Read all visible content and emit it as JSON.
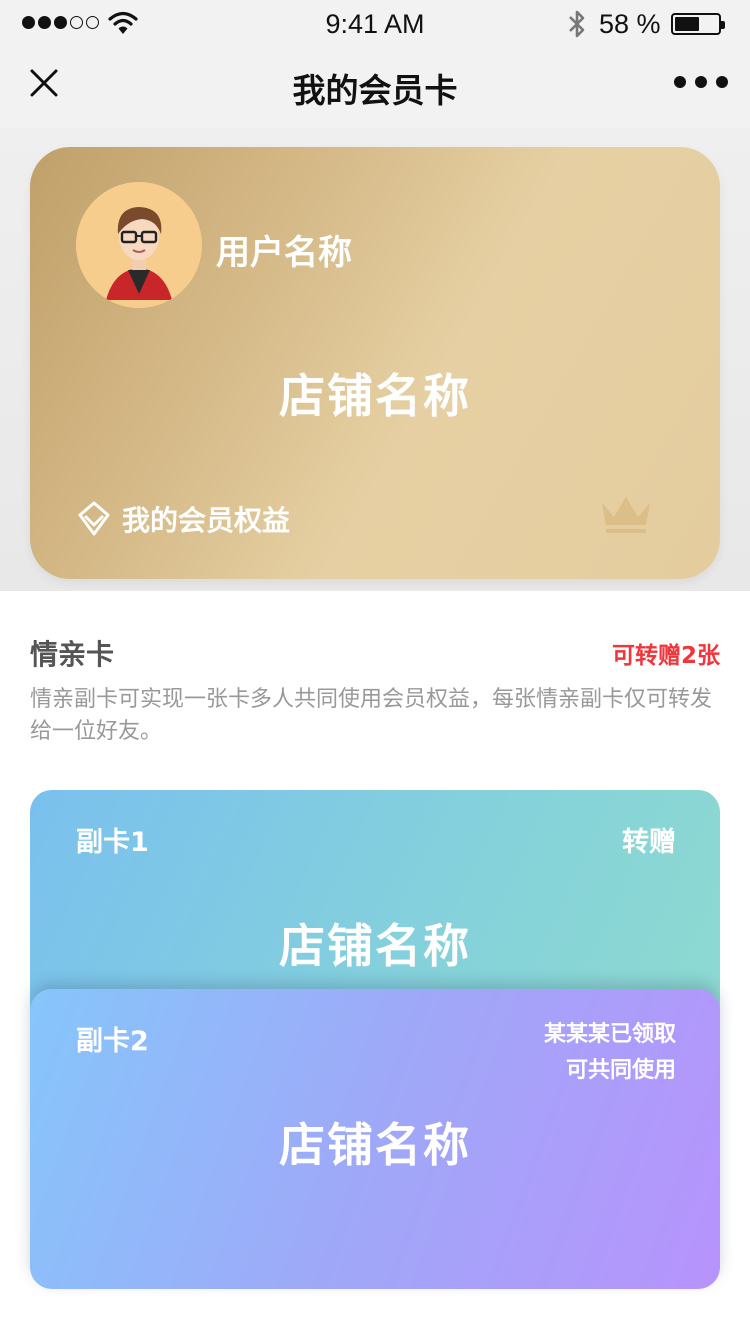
{
  "status_bar": {
    "time": "9:41 AM",
    "battery_percent": "58 %",
    "battery_level": 0.58,
    "signal_bars_filled": 3,
    "signal_bars_total": 5,
    "icons": [
      "signal-dots-icon",
      "wifi-icon",
      "bluetooth-icon",
      "battery-icon"
    ]
  },
  "nav": {
    "title": "我的会员卡",
    "close_icon": "close-icon",
    "more_icon": "more-dots-icon"
  },
  "member_card": {
    "user_name": "用户名称",
    "store_name": "店铺名称",
    "benefits_label": "我的会员权益",
    "benefits_icon": "diamond-icon",
    "badge_icon": "crown-icon",
    "colors": {
      "gradient_start": "#c0a06a",
      "gradient_end": "#e6d0a3"
    }
  },
  "relatives_section": {
    "title": "情亲卡",
    "quota": "可转赠2张",
    "description": "情亲副卡可实现一张卡多人共同使用会员权益，每张情亲副卡仅可转发给一位好友。",
    "quota_color": "#f0363c"
  },
  "sub_cards": [
    {
      "name": "副卡1",
      "action": "转赠",
      "store_name": "店铺名称"
    },
    {
      "name": "副卡2",
      "status_line1": "某某某已领取",
      "status_line2": "可共同使用",
      "store_name": "店铺名称"
    }
  ]
}
